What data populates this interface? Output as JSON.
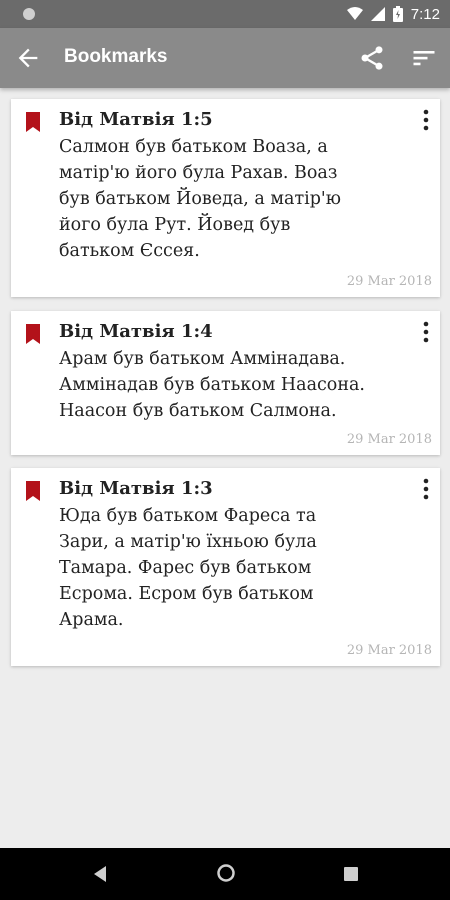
{
  "status_bar": {
    "time": "7:12"
  },
  "app_bar": {
    "title": "Bookmarks"
  },
  "bookmarks": [
    {
      "reference": "Від Матвія 1:5",
      "lines": [
        "Салмон був батьком Воаза, а",
        "матір'ю його була Рахав. Воаз",
        "був батьком Йоведа, а матір'ю",
        "його була Рут. Йовед був",
        "батьком Єссея."
      ],
      "date": "29 Mar 2018"
    },
    {
      "reference": "Від Матвія 1:4",
      "lines": [
        "Арам був батьком Аммінадава.",
        "Аммінадав був батьком Наасона.",
        "Наасон був батьком Салмона."
      ],
      "date": "29 Mar 2018"
    },
    {
      "reference": "Від Матвія 1:3",
      "lines": [
        "Юда був батьком Фареса та",
        "Зари, а матір'ю їхньою була",
        "Тамара. Фарес був батьком",
        "Есрома. Есром був батьком",
        "Арама."
      ],
      "date": "29 Mar 2018"
    }
  ],
  "colors": {
    "app_bar": "#8a8a8a",
    "status_bar": "#6b6b6b",
    "bookmark": "#b3121a",
    "background": "#ededed"
  },
  "icons": {
    "back": "arrow-left-icon",
    "share": "share-icon",
    "sort": "sort-icon",
    "bookmark": "bookmark-icon",
    "more": "more-vertical-icon"
  }
}
